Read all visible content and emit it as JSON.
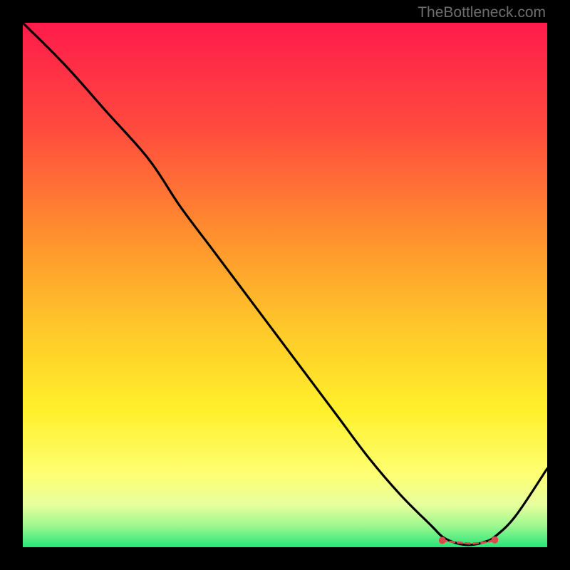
{
  "watermark": "TheBottleneck.com",
  "chart_data": {
    "type": "line",
    "title": "",
    "xlabel": "",
    "ylabel": "",
    "xlim": [
      0,
      100
    ],
    "ylim": [
      0,
      100
    ],
    "grid": false,
    "legend": false,
    "series": [
      {
        "name": "curve",
        "x": [
          0,
          8,
          16,
          24,
          30,
          36,
          42,
          48,
          54,
          60,
          66,
          72,
          78,
          80,
          82,
          84,
          86,
          88,
          90,
          94,
          100
        ],
        "values": [
          100,
          92,
          83,
          74,
          65,
          57,
          49,
          41,
          33,
          25,
          17,
          10,
          4,
          2,
          1,
          0.5,
          0.5,
          1,
          2,
          6,
          15
        ]
      }
    ],
    "markers": {
      "name": "optimum-range",
      "x": [
        80,
        82,
        84,
        85,
        86,
        87,
        88,
        89,
        90
      ],
      "y": [
        1.3,
        1.0,
        0.8,
        0.7,
        0.7,
        0.8,
        0.9,
        1.1,
        1.4
      ],
      "color": "#D94A4A"
    },
    "background_gradient": {
      "stops": [
        {
          "offset": 0.0,
          "color": "#FF1B4B"
        },
        {
          "offset": 0.2,
          "color": "#FF4A3E"
        },
        {
          "offset": 0.4,
          "color": "#FF8E2E"
        },
        {
          "offset": 0.58,
          "color": "#FFC72A"
        },
        {
          "offset": 0.74,
          "color": "#FFF02B"
        },
        {
          "offset": 0.86,
          "color": "#FFFF73"
        },
        {
          "offset": 0.92,
          "color": "#E6FF9E"
        },
        {
          "offset": 0.96,
          "color": "#9CF78F"
        },
        {
          "offset": 1.0,
          "color": "#27E67A"
        }
      ]
    }
  }
}
